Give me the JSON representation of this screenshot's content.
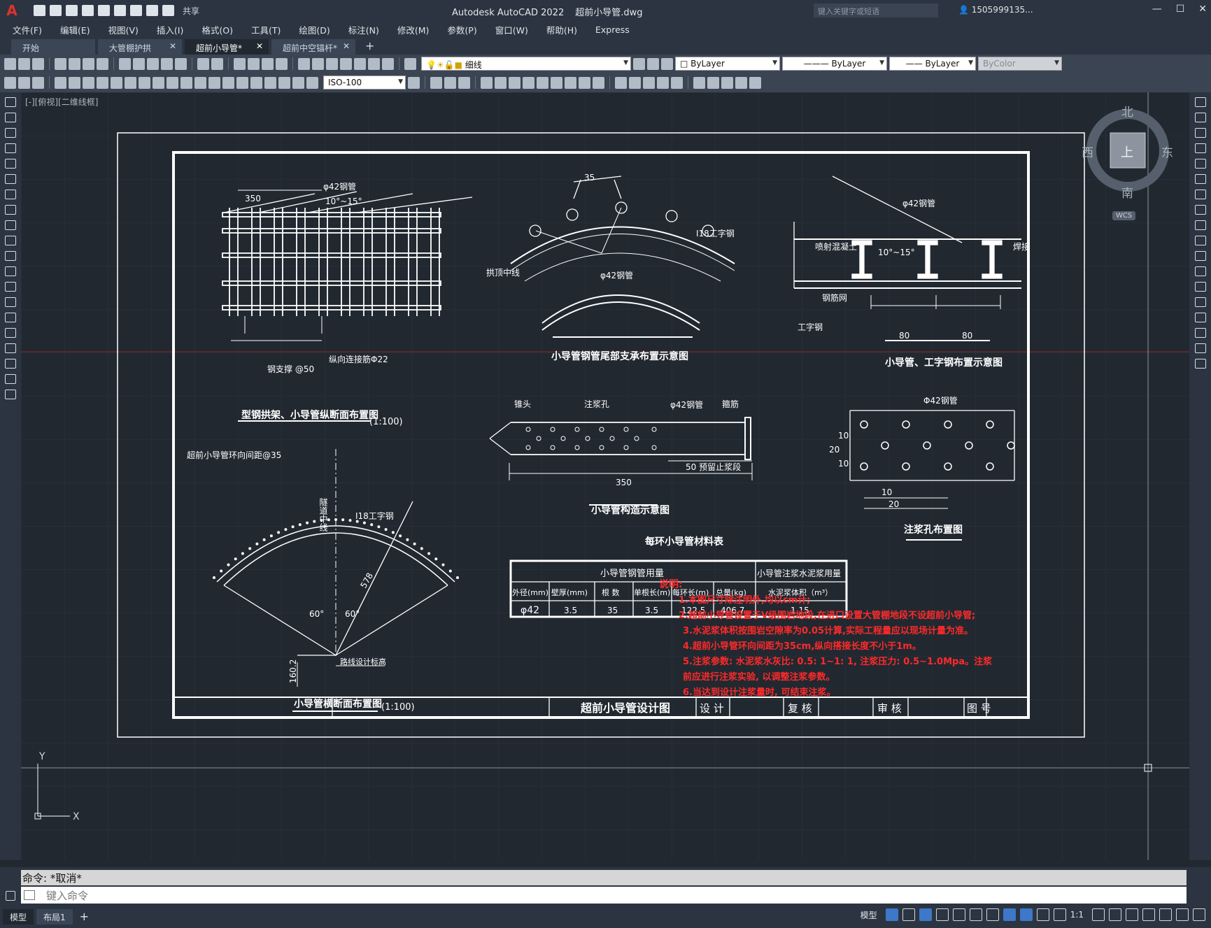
{
  "app": {
    "logo": "A",
    "title": "Autodesk AutoCAD 2022",
    "filename": "超前小导管.dwg",
    "share_label": "共享",
    "search_placeholder": "键入关键字或短语",
    "user": "1505999135...",
    "window_controls": [
      "—",
      "☐",
      "✕"
    ]
  },
  "menu": [
    "文件(F)",
    "编辑(E)",
    "视图(V)",
    "插入(I)",
    "格式(O)",
    "工具(T)",
    "绘图(D)",
    "标注(N)",
    "修改(M)",
    "参数(P)",
    "窗口(W)",
    "帮助(H)",
    "Express"
  ],
  "tabs": [
    {
      "label": "开始",
      "closable": false,
      "active": false
    },
    {
      "label": "大管棚护拱",
      "closable": true,
      "active": false
    },
    {
      "label": "超前小导管*",
      "closable": true,
      "active": true
    },
    {
      "label": "超前中空锚杆*",
      "closable": true,
      "active": false
    }
  ],
  "new_tab_label": "+",
  "toolbar": {
    "layer_name": "细线",
    "color": "ByLayer",
    "linetype": "ByLayer",
    "lineweight": "ByLayer",
    "plotstyle": "ByColor",
    "dimstyle": "ISO-100"
  },
  "view_label": "[-][俯视][二维线框]",
  "viewcube": {
    "north": "北",
    "south": "南",
    "east": "东",
    "west": "西",
    "top": "上",
    "wcs": "WCS"
  },
  "ucs": {
    "x": "X",
    "y": "Y"
  },
  "drawing": {
    "title_block": {
      "name": "超前小导管设计图",
      "design": "设 计",
      "check": "复 核",
      "review": "审 核",
      "number": "图 号"
    },
    "fig1_title": "型钢拱架、小导管纵断面布置图",
    "fig1_scale": "(1:100)",
    "fig1_labels": {
      "dim": "350",
      "pipe": "φ42钢管",
      "angle": "10°~15°",
      "brace": "钢支撑 @50",
      "rebar": "纵向连接筋Φ22"
    },
    "fig2_title": "小导管钢管尾部支承布置示意图",
    "fig2_labels": {
      "dim": "35",
      "beam": "I18工字钢",
      "arch": "拱顶中线",
      "pipe": "φ42钢管"
    },
    "fig3_title": "小导管、工字钢布置示意图",
    "fig3_labels": {
      "pipe": "φ42钢管",
      "shotcrete": "喷射混凝土",
      "angle": "10°~15°",
      "weld": "焊接",
      "mesh": "钢筋网",
      "beam": "工字钢",
      "dim1": "80",
      "dim2": "80"
    },
    "fig4_title": "小导管构造示意图",
    "fig4_labels": {
      "tip": "锥头",
      "hole": "注浆孔",
      "pipe": "φ42钢管",
      "ring": "箍筋",
      "stop": "50 预留止浆段",
      "len": "350"
    },
    "fig5_title": "注浆孔布置图",
    "fig5_labels": {
      "pipe": "Φ42钢管",
      "d20": "20",
      "d10a": "10",
      "d10b": "10",
      "b10": "10",
      "b20": "20"
    },
    "fig6_title": "小导管横断面布置图",
    "fig6_scale": "(1:100)",
    "fig6_labels": {
      "spacing": "超前小导管环向间距@35",
      "beam": "I18工字钢",
      "center": "隧道中线",
      "radius": "578",
      "a1": "60°",
      "a2": "60°",
      "h": "160.2",
      "grade": "路线设计标高"
    },
    "table": {
      "title": "每环小导管材料表",
      "group1": "小导管钢管用量",
      "group2": "小导管注浆水泥浆用量",
      "headers": [
        "外径(mm)",
        "壁厚(mm)",
        "根 数",
        "单根长(m)",
        "每环长(m)",
        "总量(kg)",
        "水泥浆体积（m³）"
      ],
      "row": [
        "φ42",
        "3.5",
        "35",
        "3.5",
        "122.5",
        "406.7",
        "1.15"
      ]
    },
    "notes": {
      "heading": "说明:",
      "lines": [
        "1.本图尺寸除注明外,均以cm计;",
        "2.超前小导管设置于Ⅴ级围岩地段,在进口设置大管棚地段不设超前小导管;",
        "3.水泥浆体积按围岩空隙率为0.05计算,实际工程量应以现场计量为准。",
        "4.超前小导管环向间距为35cm,纵向搭接长度不小于1m。",
        "5.注浆参数: 水泥浆水灰比: 0.5: 1~1: 1, 注浆压力: 0.5~1.0Mpa。注浆",
        "前应进行注浆实验, 以调整注浆参数。",
        "6.当达到设计注浆量时, 可结束注浆。"
      ]
    }
  },
  "command": {
    "history": "命令: *取消*",
    "placeholder": "键入命令"
  },
  "status": {
    "tabs": [
      "模型",
      "布局1"
    ],
    "add": "+",
    "model": "模型",
    "scale": "1:1"
  },
  "colors": {
    "background": "#212830",
    "notes": "#ff2a2a",
    "lines": "#ffffff",
    "accent": "#3d78c9"
  }
}
